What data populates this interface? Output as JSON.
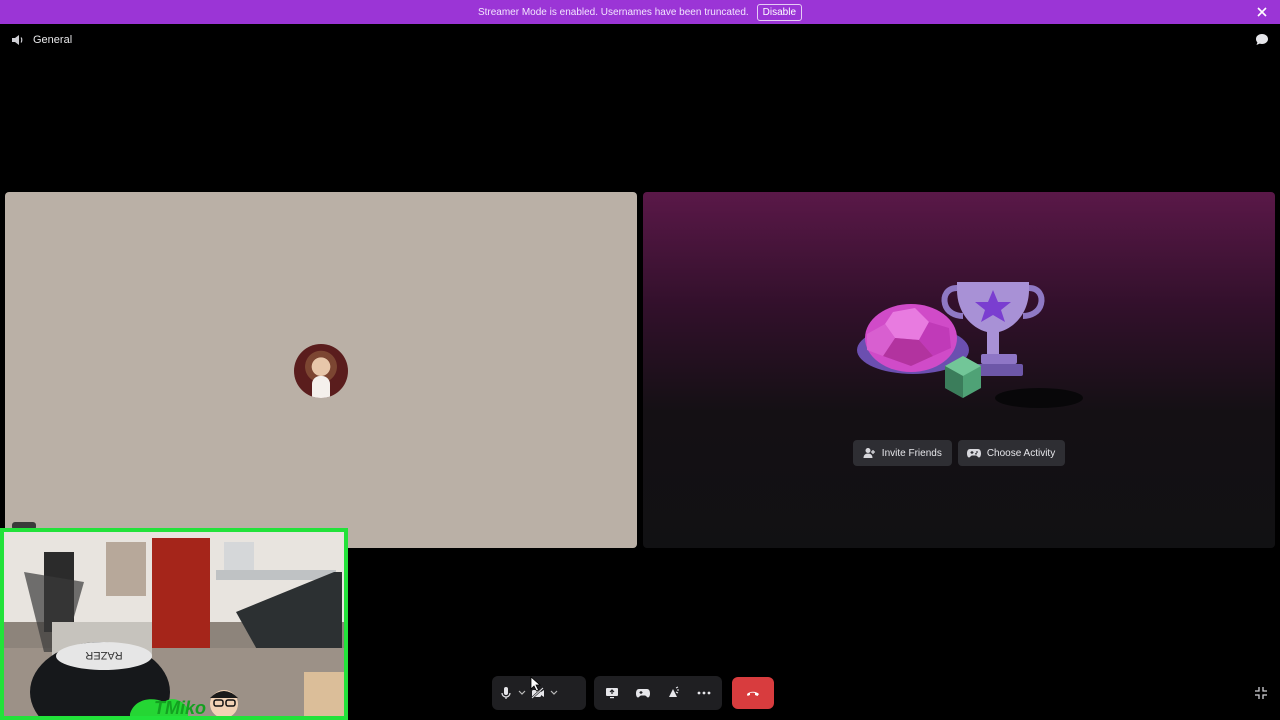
{
  "banner": {
    "message": "Streamer Mode is enabled. Usernames have been truncated.",
    "disable_label": "Disable",
    "color": "#9b35d6"
  },
  "channel": {
    "name": "General",
    "icon": "speaker-icon"
  },
  "activity_tile": {
    "invite_label": "Invite Friends",
    "choose_label": "Choose Activity",
    "invite_icon": "add-friend-icon",
    "choose_icon": "gamepad-icon"
  },
  "controls": {
    "icons": [
      "microphone-icon",
      "camera-off-icon",
      "screen-share-icon",
      "activity-icon",
      "soundboard-icon",
      "more-icon",
      "hang-up-icon"
    ],
    "hangup_color": "#d83c3e"
  },
  "selfview": {
    "border_color": "#22e23a",
    "overlay_text": "TMiko",
    "headband_text": "RAZER"
  },
  "colors": {
    "left_tile": "#bab0a6",
    "banner": "#9b35d6"
  }
}
